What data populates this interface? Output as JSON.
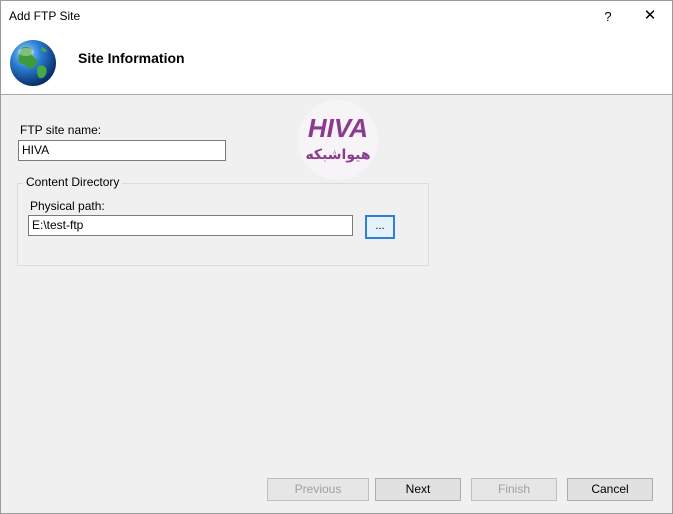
{
  "window": {
    "title": "Add FTP Site",
    "help": "?",
    "close": "✕"
  },
  "header": {
    "title": "Site Information",
    "icon": "globe-icon"
  },
  "form": {
    "site_name_label": "FTP site name:",
    "site_name_value": "HIVA",
    "group_title": "Content Directory",
    "physical_path_label": "Physical path:",
    "physical_path_value": "E:\\test-ftp",
    "browse_label": "..."
  },
  "watermark": {
    "latin": "HIVA",
    "persian": "هیواشبکه",
    "color": "#8b3a8f"
  },
  "buttons": {
    "previous": "Previous",
    "next": "Next",
    "finish": "Finish",
    "cancel": "Cancel"
  }
}
